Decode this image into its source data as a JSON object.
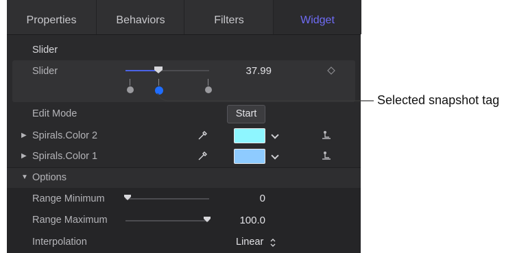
{
  "tabs": [
    {
      "label": "Properties"
    },
    {
      "label": "Behaviors"
    },
    {
      "label": "Filters"
    },
    {
      "label": "Widget"
    }
  ],
  "slider_section": {
    "header": "Slider"
  },
  "slider_row": {
    "label": "Slider",
    "value": "37.99",
    "level": 0.38,
    "snapshot_tags": 3,
    "selected_tag": 2
  },
  "edit_mode": {
    "label": "Edit Mode",
    "button": "Start"
  },
  "color_rows": [
    {
      "label": "Spirals.Color 2",
      "color": "#8ef6ff"
    },
    {
      "label": "Spirals.Color 1",
      "color": "#8ecbff"
    }
  ],
  "options": {
    "header": "Options",
    "range_min": {
      "label": "Range Minimum",
      "value": "0",
      "level": 0.0
    },
    "range_max": {
      "label": "Range Maximum",
      "value": "100.0",
      "level": 1.0
    },
    "interpolation": {
      "label": "Interpolation",
      "value": "Linear"
    }
  },
  "callout": {
    "text": "Selected snapshot tag"
  },
  "colors": {
    "accent": "#4b63e8",
    "tab_active": "#6f6cf6",
    "panel_bg": "#2a2a2c"
  }
}
